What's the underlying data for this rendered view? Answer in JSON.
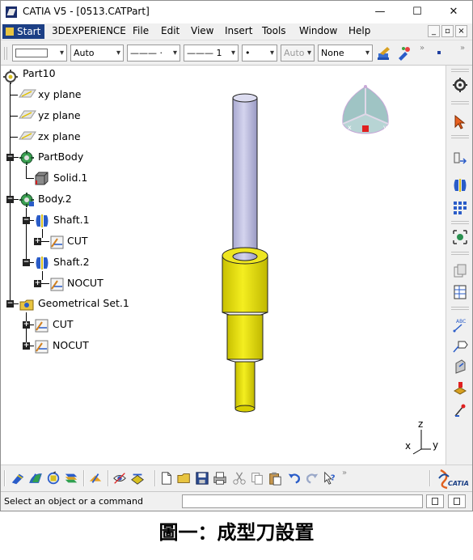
{
  "window": {
    "title": "CATIA V5 - [0513.CATPart]",
    "minimize_glyph": "—",
    "maximize_glyph": "☐",
    "close_glyph": "✕"
  },
  "menubar": {
    "start": "Start",
    "items": [
      "3DEXPERIENCE",
      "File",
      "Edit",
      "View",
      "Insert",
      "Tools",
      "Window",
      "Help"
    ],
    "mdi_buttons": [
      "_",
      "▫",
      "×"
    ]
  },
  "properties_toolbar": {
    "color_combo": "",
    "transparency_combo": "Auto",
    "linetype_combo": "———  ·",
    "thickness_combo": "——— 1",
    "point_combo": "•",
    "layer_combo": "Auto",
    "render_combo": "None"
  },
  "spec_tree": {
    "root": "Part10",
    "nodes": [
      {
        "label": "xy plane",
        "icon": "plane-icon"
      },
      {
        "label": "yz plane",
        "icon": "plane-icon"
      },
      {
        "label": "zx plane",
        "icon": "plane-icon"
      },
      {
        "label": "PartBody",
        "icon": "body-icon"
      },
      {
        "label": "Solid.1",
        "icon": "solid-icon"
      },
      {
        "label": "Body.2",
        "icon": "body-icon"
      },
      {
        "label": "Shaft.1",
        "icon": "shaft-icon"
      },
      {
        "label": "CUT",
        "icon": "sketch-icon"
      },
      {
        "label": "Shaft.2",
        "icon": "shaft-icon"
      },
      {
        "label": "NOCUT",
        "icon": "sketch-icon"
      },
      {
        "label": "Geometrical Set.1",
        "icon": "geometrical-set-icon"
      },
      {
        "label": "CUT",
        "icon": "sketch-icon"
      },
      {
        "label": "NOCUT",
        "icon": "sketch-icon"
      }
    ]
  },
  "axis": {
    "z": "z",
    "x": "x",
    "y": "y"
  },
  "brand": {
    "label": "CATIA"
  },
  "statusbar": {
    "message": "Select an object or a command"
  },
  "caption": "圖一：成型刀設置",
  "colors": {
    "tool_yellow": "#e8e000",
    "shaft_lavender": "#c8c8e8",
    "tree_line": "#000000",
    "compass_teal": "#9fc4c4",
    "start_blue": "#1c3f85"
  }
}
